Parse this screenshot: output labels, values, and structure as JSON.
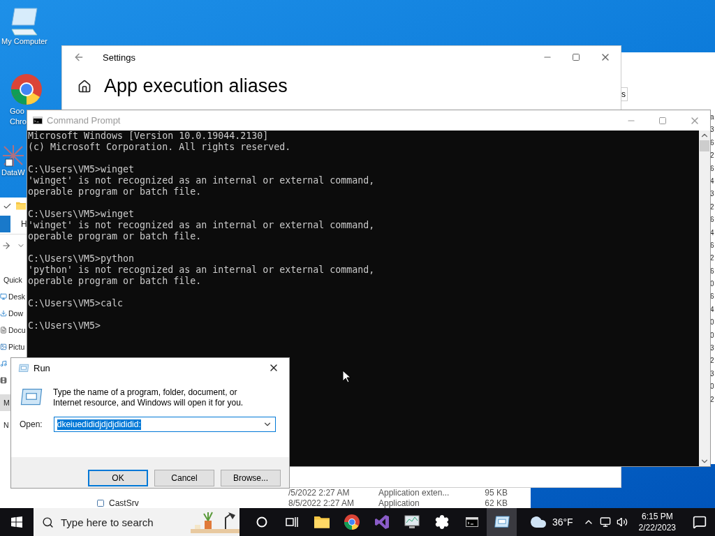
{
  "desktop_icons": [
    {
      "label": "My Computer",
      "kind": "computer"
    },
    {
      "label": "Goo Chro",
      "kind": "chrome"
    },
    {
      "label": "DataW",
      "kind": "app"
    }
  ],
  "explorer": {
    "ribbon_tab": "H",
    "sidebar": [
      {
        "label": "Quick",
        "kind": "header",
        "selected": false
      },
      {
        "label": "Desk",
        "kind": "desktop",
        "selected": false
      },
      {
        "label": "Dow",
        "kind": "downloads",
        "selected": false
      },
      {
        "label": "Docu",
        "kind": "documents",
        "selected": false
      },
      {
        "label": "Pictu",
        "kind": "pictures",
        "selected": false
      },
      {
        "kind": "music",
        "selected": false
      },
      {
        "kind": "video",
        "selected": false
      },
      {
        "label": "M",
        "kind": "header",
        "selected": true
      },
      {
        "label": "N",
        "kind": "header",
        "selected": false
      }
    ],
    "rows": [
      {
        "date": "/5/2022 2:27 AM",
        "type": "Application exten...",
        "size": "95 KB"
      },
      {
        "name": "CastSrv",
        "date": "8/5/2022 2:27 AM",
        "type": "Application",
        "size": "62 KB"
      }
    ]
  },
  "back_window": {
    "tab": "s",
    "column_header": "a",
    "cells": [
      "3",
      "6",
      "2",
      "6",
      "4",
      "3",
      "2",
      "6",
      "4",
      "6",
      "2",
      "6",
      "0",
      "6",
      "4",
      "0",
      "0",
      "3",
      "2",
      "3",
      "0",
      "2"
    ]
  },
  "settings": {
    "title": "Settings",
    "heading": "App execution aliases"
  },
  "console": {
    "title": "Command Prompt",
    "blocks": [
      [
        "Microsoft Windows [Version 10.0.19044.2130]",
        "(c) Microsoft Corporation. All rights reserved."
      ],
      [
        "C:\\Users\\VM5>winget",
        "'winget' is not recognized as an internal or external command,",
        "operable program or batch file."
      ],
      [
        "C:\\Users\\VM5>winget",
        "'winget' is not recognized as an internal or external command,",
        "operable program or batch file."
      ],
      [
        "C:\\Users\\VM5>python",
        "'python' is not recognized as an internal or external command,",
        "operable program or batch file."
      ],
      [
        "C:\\Users\\VM5>calc"
      ],
      [
        "C:\\Users\\VM5>"
      ]
    ]
  },
  "run_dialog": {
    "title": "Run",
    "description": "Type the name of a program, folder, document, or Internet resource, and Windows will open it for you.",
    "open_label": "Open:",
    "value": "dkeiuedididjdjdjdididid:",
    "buttons": [
      {
        "label": "OK",
        "default": true
      },
      {
        "label": "Cancel",
        "default": false
      },
      {
        "label": "Browse...",
        "default": false
      }
    ]
  },
  "taskbar": {
    "search_placeholder": "Type here to search",
    "apps": [
      {
        "kind": "cortana",
        "selected": false
      },
      {
        "kind": "taskview",
        "selected": false
      },
      {
        "kind": "explorer",
        "selected": false
      },
      {
        "kind": "chrome",
        "selected": false
      },
      {
        "kind": "studio",
        "selected": false
      },
      {
        "kind": "monitor",
        "selected": false
      },
      {
        "kind": "settings",
        "selected": false
      },
      {
        "kind": "console",
        "selected": false
      },
      {
        "kind": "run",
        "selected": true
      }
    ],
    "weather": "36°F",
    "time": "6:15 PM",
    "date": "2/22/2023"
  }
}
